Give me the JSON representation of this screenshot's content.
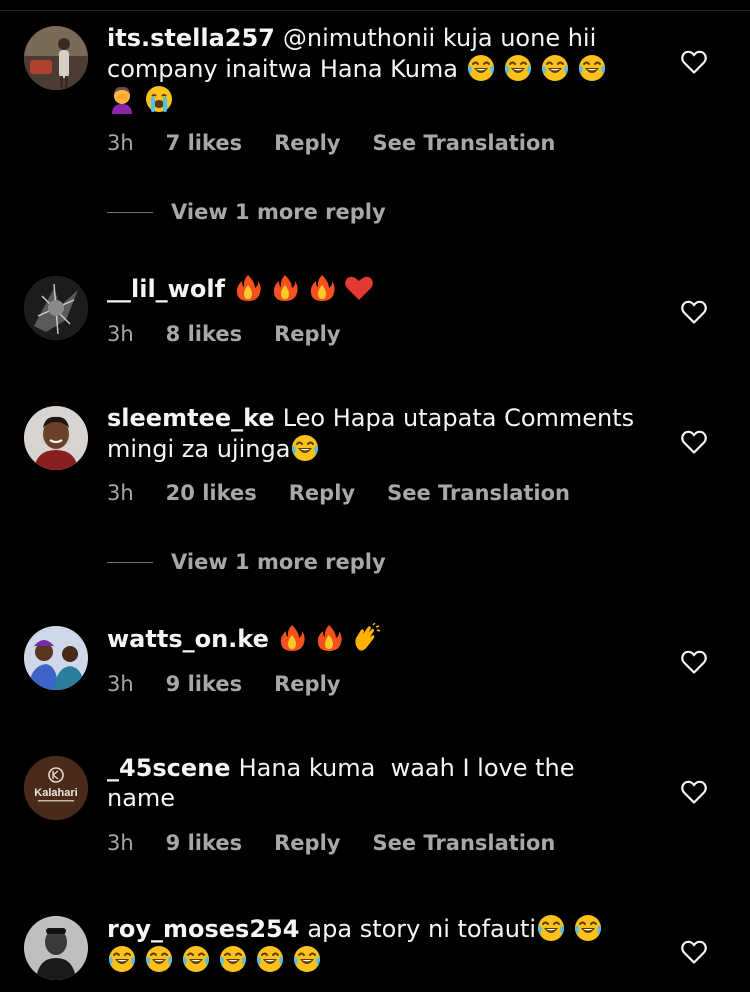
{
  "comments": [
    {
      "username": "its.stella257",
      "text": "@nimuthonii kuja uone hii company inaitwa Hana Kuma",
      "emojis": [
        "laughing-tears-emoji",
        "laughing-tears-emoji",
        "laughing-tears-emoji",
        "laughing-tears-emoji",
        "facepalm-emoji",
        "crying-emoji"
      ],
      "time": "3h",
      "likes": "7 likes",
      "reply": "Reply",
      "translation": "See Translation",
      "more_replies": "View 1 more reply"
    },
    {
      "username": "__lil_wolf",
      "text": "",
      "emojis": [
        "fire-emoji",
        "fire-emoji",
        "fire-emoji",
        "red-heart-emoji"
      ],
      "time": "3h",
      "likes": "8 likes",
      "reply": "Reply"
    },
    {
      "username": "sleemtee_ke",
      "text": "Leo Hapa utapata Comments mingi za ujinga",
      "emojis": [
        "laughing-tears-emoji"
      ],
      "time": "3h",
      "likes": "20 likes",
      "reply": "Reply",
      "translation": "See Translation",
      "more_replies": "View 1 more reply"
    },
    {
      "username": "watts_on.ke",
      "text": "",
      "emojis": [
        "fire-emoji",
        "fire-emoji",
        "clapping-emoji"
      ],
      "time": "3h",
      "likes": "9 likes",
      "reply": "Reply"
    },
    {
      "username": "_45scene",
      "text": "Hana kuma  waah I love the name",
      "avatar_text": "Kalahari",
      "time": "3h",
      "likes": "9 likes",
      "reply": "Reply",
      "translation": "See Translation"
    },
    {
      "username": "roy_moses254",
      "text": "apa story ni tofauti",
      "emojis": [
        "laughing-tears-emoji",
        "laughing-tears-emoji",
        "laughing-tears-emoji",
        "laughing-tears-emoji",
        "laughing-tears-emoji",
        "laughing-tears-emoji",
        "laughing-tears-emoji",
        "laughing-tears-emoji"
      ]
    }
  ],
  "icons": {
    "like": "heart-outline-icon"
  },
  "colors": {
    "background": "#000000",
    "text": "#f5f5f5",
    "secondary_text": "#a8a8a8"
  }
}
